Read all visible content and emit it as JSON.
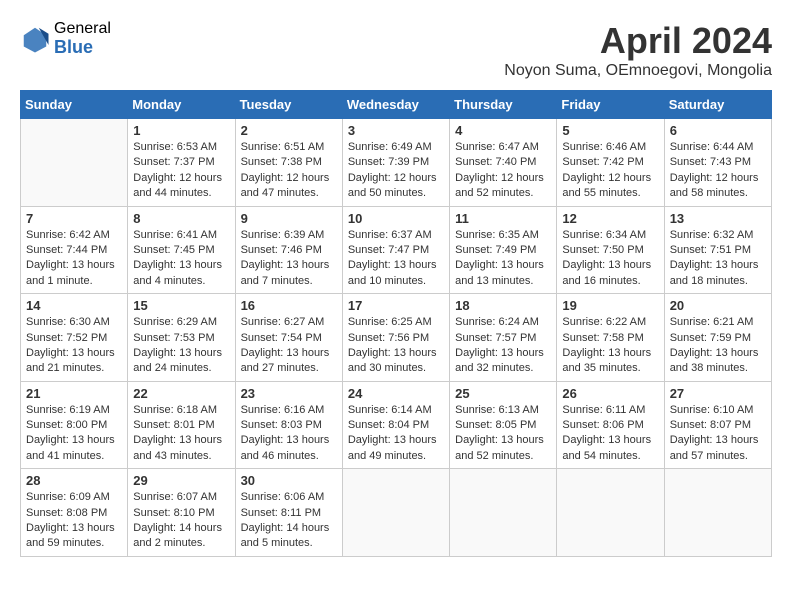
{
  "header": {
    "logo_general": "General",
    "logo_blue": "Blue",
    "month_title": "April 2024",
    "location": "Noyon Suma, OEmnoegovi, Mongolia"
  },
  "weekdays": [
    "Sunday",
    "Monday",
    "Tuesday",
    "Wednesday",
    "Thursday",
    "Friday",
    "Saturday"
  ],
  "weeks": [
    [
      {
        "day": null,
        "content": null
      },
      {
        "day": "1",
        "content": "Sunrise: 6:53 AM\nSunset: 7:37 PM\nDaylight: 12 hours\nand 44 minutes."
      },
      {
        "day": "2",
        "content": "Sunrise: 6:51 AM\nSunset: 7:38 PM\nDaylight: 12 hours\nand 47 minutes."
      },
      {
        "day": "3",
        "content": "Sunrise: 6:49 AM\nSunset: 7:39 PM\nDaylight: 12 hours\nand 50 minutes."
      },
      {
        "day": "4",
        "content": "Sunrise: 6:47 AM\nSunset: 7:40 PM\nDaylight: 12 hours\nand 52 minutes."
      },
      {
        "day": "5",
        "content": "Sunrise: 6:46 AM\nSunset: 7:42 PM\nDaylight: 12 hours\nand 55 minutes."
      },
      {
        "day": "6",
        "content": "Sunrise: 6:44 AM\nSunset: 7:43 PM\nDaylight: 12 hours\nand 58 minutes."
      }
    ],
    [
      {
        "day": "7",
        "content": "Sunrise: 6:42 AM\nSunset: 7:44 PM\nDaylight: 13 hours\nand 1 minute."
      },
      {
        "day": "8",
        "content": "Sunrise: 6:41 AM\nSunset: 7:45 PM\nDaylight: 13 hours\nand 4 minutes."
      },
      {
        "day": "9",
        "content": "Sunrise: 6:39 AM\nSunset: 7:46 PM\nDaylight: 13 hours\nand 7 minutes."
      },
      {
        "day": "10",
        "content": "Sunrise: 6:37 AM\nSunset: 7:47 PM\nDaylight: 13 hours\nand 10 minutes."
      },
      {
        "day": "11",
        "content": "Sunrise: 6:35 AM\nSunset: 7:49 PM\nDaylight: 13 hours\nand 13 minutes."
      },
      {
        "day": "12",
        "content": "Sunrise: 6:34 AM\nSunset: 7:50 PM\nDaylight: 13 hours\nand 16 minutes."
      },
      {
        "day": "13",
        "content": "Sunrise: 6:32 AM\nSunset: 7:51 PM\nDaylight: 13 hours\nand 18 minutes."
      }
    ],
    [
      {
        "day": "14",
        "content": "Sunrise: 6:30 AM\nSunset: 7:52 PM\nDaylight: 13 hours\nand 21 minutes."
      },
      {
        "day": "15",
        "content": "Sunrise: 6:29 AM\nSunset: 7:53 PM\nDaylight: 13 hours\nand 24 minutes."
      },
      {
        "day": "16",
        "content": "Sunrise: 6:27 AM\nSunset: 7:54 PM\nDaylight: 13 hours\nand 27 minutes."
      },
      {
        "day": "17",
        "content": "Sunrise: 6:25 AM\nSunset: 7:56 PM\nDaylight: 13 hours\nand 30 minutes."
      },
      {
        "day": "18",
        "content": "Sunrise: 6:24 AM\nSunset: 7:57 PM\nDaylight: 13 hours\nand 32 minutes."
      },
      {
        "day": "19",
        "content": "Sunrise: 6:22 AM\nSunset: 7:58 PM\nDaylight: 13 hours\nand 35 minutes."
      },
      {
        "day": "20",
        "content": "Sunrise: 6:21 AM\nSunset: 7:59 PM\nDaylight: 13 hours\nand 38 minutes."
      }
    ],
    [
      {
        "day": "21",
        "content": "Sunrise: 6:19 AM\nSunset: 8:00 PM\nDaylight: 13 hours\nand 41 minutes."
      },
      {
        "day": "22",
        "content": "Sunrise: 6:18 AM\nSunset: 8:01 PM\nDaylight: 13 hours\nand 43 minutes."
      },
      {
        "day": "23",
        "content": "Sunrise: 6:16 AM\nSunset: 8:03 PM\nDaylight: 13 hours\nand 46 minutes."
      },
      {
        "day": "24",
        "content": "Sunrise: 6:14 AM\nSunset: 8:04 PM\nDaylight: 13 hours\nand 49 minutes."
      },
      {
        "day": "25",
        "content": "Sunrise: 6:13 AM\nSunset: 8:05 PM\nDaylight: 13 hours\nand 52 minutes."
      },
      {
        "day": "26",
        "content": "Sunrise: 6:11 AM\nSunset: 8:06 PM\nDaylight: 13 hours\nand 54 minutes."
      },
      {
        "day": "27",
        "content": "Sunrise: 6:10 AM\nSunset: 8:07 PM\nDaylight: 13 hours\nand 57 minutes."
      }
    ],
    [
      {
        "day": "28",
        "content": "Sunrise: 6:09 AM\nSunset: 8:08 PM\nDaylight: 13 hours\nand 59 minutes."
      },
      {
        "day": "29",
        "content": "Sunrise: 6:07 AM\nSunset: 8:10 PM\nDaylight: 14 hours\nand 2 minutes."
      },
      {
        "day": "30",
        "content": "Sunrise: 6:06 AM\nSunset: 8:11 PM\nDaylight: 14 hours\nand 5 minutes."
      },
      {
        "day": null,
        "content": null
      },
      {
        "day": null,
        "content": null
      },
      {
        "day": null,
        "content": null
      },
      {
        "day": null,
        "content": null
      }
    ]
  ]
}
